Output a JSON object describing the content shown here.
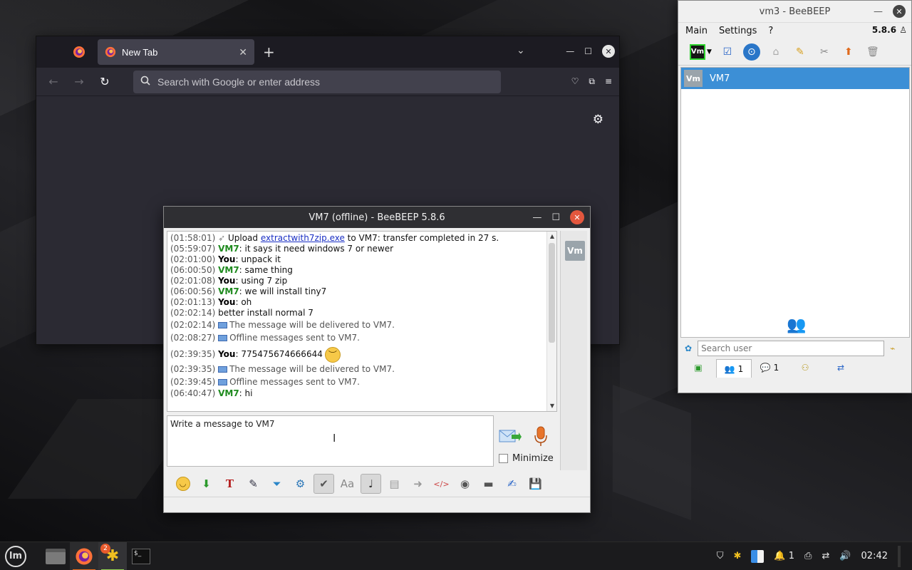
{
  "firefox": {
    "tab_title": "New Tab",
    "url_placeholder": "Search with Google or enter address"
  },
  "chat": {
    "title": "VM7 (offline) - BeeBEEP 5.8.6",
    "messages": [
      {
        "time": "(01:58:01)",
        "sender": "",
        "pre": " Upload ",
        "link": "extractwith7zip.exe",
        "text": " to VM7: transfer completed in 27 s.",
        "kind": "upload"
      },
      {
        "time": "(05:59:07)",
        "sender": "VM7",
        "text": ": it says it need windows 7 or newer",
        "kind": "vm7"
      },
      {
        "time": "(02:01:00)",
        "sender": "You",
        "text": ": unpack it",
        "kind": "you"
      },
      {
        "time": "(06:00:50)",
        "sender": "VM7",
        "text": ": same thing",
        "kind": "vm7"
      },
      {
        "time": "(02:01:08)",
        "sender": "You",
        "text": ": using 7 zip",
        "kind": "you"
      },
      {
        "time": "(06:00:56)",
        "sender": "VM7",
        "text": ": we will install tiny7",
        "kind": "vm7"
      },
      {
        "time": "(02:01:13)",
        "sender": "You",
        "text": ": oh",
        "kind": "you"
      },
      {
        "time": "(02:02:14)",
        "sender": "",
        "text": "   better install normal 7",
        "kind": "cont"
      },
      {
        "time": "(02:02:14)",
        "sender": "",
        "text": "The message will be delivered to VM7.",
        "kind": "sys"
      },
      {
        "time": "(02:08:27)",
        "sender": "",
        "text": "Offline messages sent to VM7.",
        "kind": "sys"
      },
      {
        "time": "(02:39:35)",
        "sender": "You",
        "text": ": 775475674666644",
        "kind": "you-emo"
      },
      {
        "time": "(02:39:35)",
        "sender": "",
        "text": "The message will be delivered to VM7.",
        "kind": "sys"
      },
      {
        "time": "(02:39:45)",
        "sender": "",
        "text": "Offline messages sent to VM7.",
        "kind": "sys"
      },
      {
        "time": "(06:40:47)",
        "sender": "VM7",
        "text": ": hi",
        "kind": "vm7"
      }
    ],
    "side_badge": "Vm",
    "input_placeholder": "Write a message to VM7",
    "minimize_label": "Minimize"
  },
  "beebeep": {
    "title": "vm3 - BeeBEEP",
    "menu": [
      "Main",
      "Settings",
      "?"
    ],
    "version": "5.8.6",
    "vm_button": "Vm",
    "user_avatar": "Vm",
    "user_name": "VM7",
    "search_placeholder": "Search user",
    "tab_users_count": "1",
    "tab_chats_count": "1"
  },
  "taskbar": {
    "badge_count": "2",
    "tray_notif_count": "1",
    "clock": "02:42"
  }
}
